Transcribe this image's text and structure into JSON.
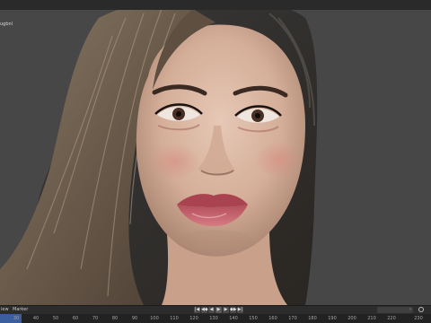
{
  "viewport": {
    "object_label": "ugbnl",
    "image_alt": "3D rendered portrait of a woman with long brown hair"
  },
  "playback": {
    "view_menu": "iew",
    "marker_menu": "Marker",
    "buttons": [
      "|◀",
      "◀◆",
      "◀",
      "▶",
      "▶",
      "◆▶",
      "▶|"
    ]
  },
  "timeline": {
    "current_frame": "",
    "ticks": [
      "30",
      "40",
      "50",
      "60",
      "70",
      "80",
      "90",
      "100",
      "110",
      "120",
      "130",
      "140",
      "150",
      "160",
      "170",
      "180",
      "190",
      "200",
      "210",
      "220",
      "230"
    ]
  },
  "colors": {
    "viewport_bg": "#474747",
    "header_bg": "#2a2a2a",
    "timeline_bg": "#222222",
    "current_frame_accent": "#3a5e9e"
  }
}
